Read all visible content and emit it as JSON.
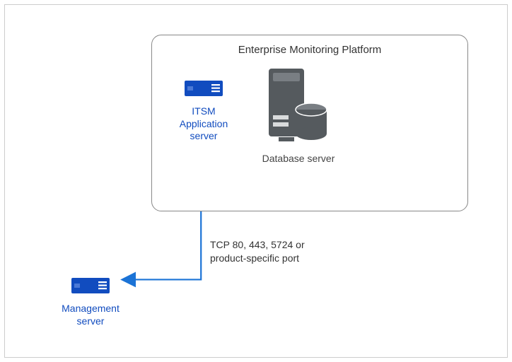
{
  "platform": {
    "title": "Enterprise Monitoring Platform"
  },
  "nodes": {
    "itsm": {
      "label": "ITSM Application server"
    },
    "database": {
      "label": "Database server"
    },
    "management": {
      "label": "Management server"
    }
  },
  "connection": {
    "label": "TCP 80, 443, 5724 or product-specific port"
  },
  "colors": {
    "accent": "#114cbf",
    "arrow": "#1b73d6",
    "server_gray": "#555a5e"
  }
}
